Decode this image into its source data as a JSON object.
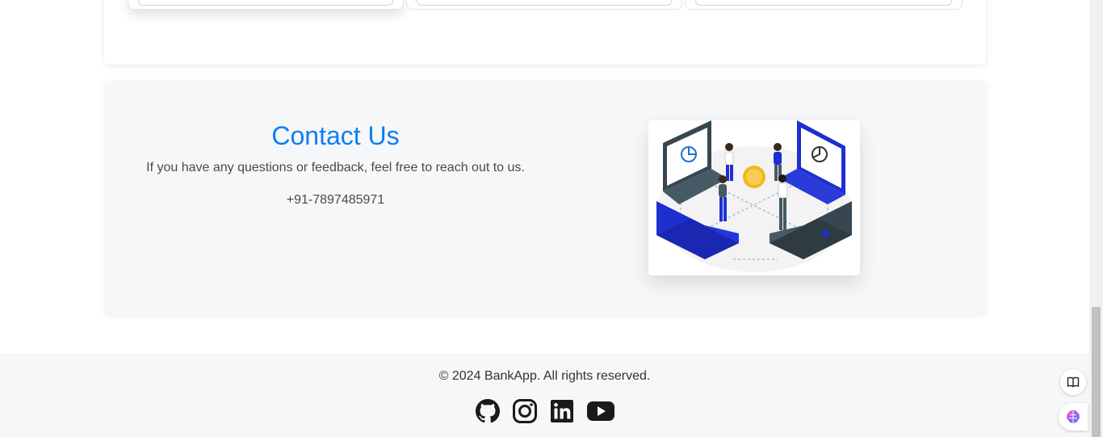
{
  "contact": {
    "title": "Contact Us",
    "description": "If you have any questions or feedback, feel free to reach out to us.",
    "phone": "+91-7897485971",
    "illustration": "people-connecting-laptops-illustration"
  },
  "footer": {
    "copyright": "© 2024 BankApp. All rights reserved.",
    "socials": [
      {
        "name": "github",
        "icon": "github-icon"
      },
      {
        "name": "instagram",
        "icon": "instagram-icon"
      },
      {
        "name": "linkedin",
        "icon": "linkedin-icon"
      },
      {
        "name": "youtube",
        "icon": "youtube-icon"
      }
    ]
  },
  "widgets": [
    {
      "icon": "book-icon"
    },
    {
      "icon": "brain-icon"
    }
  ],
  "colors": {
    "accent": "#0d7ff2",
    "illustration_blue": "#1e2fcf",
    "illustration_dark": "#37474f",
    "coin": "#f2b81c"
  }
}
